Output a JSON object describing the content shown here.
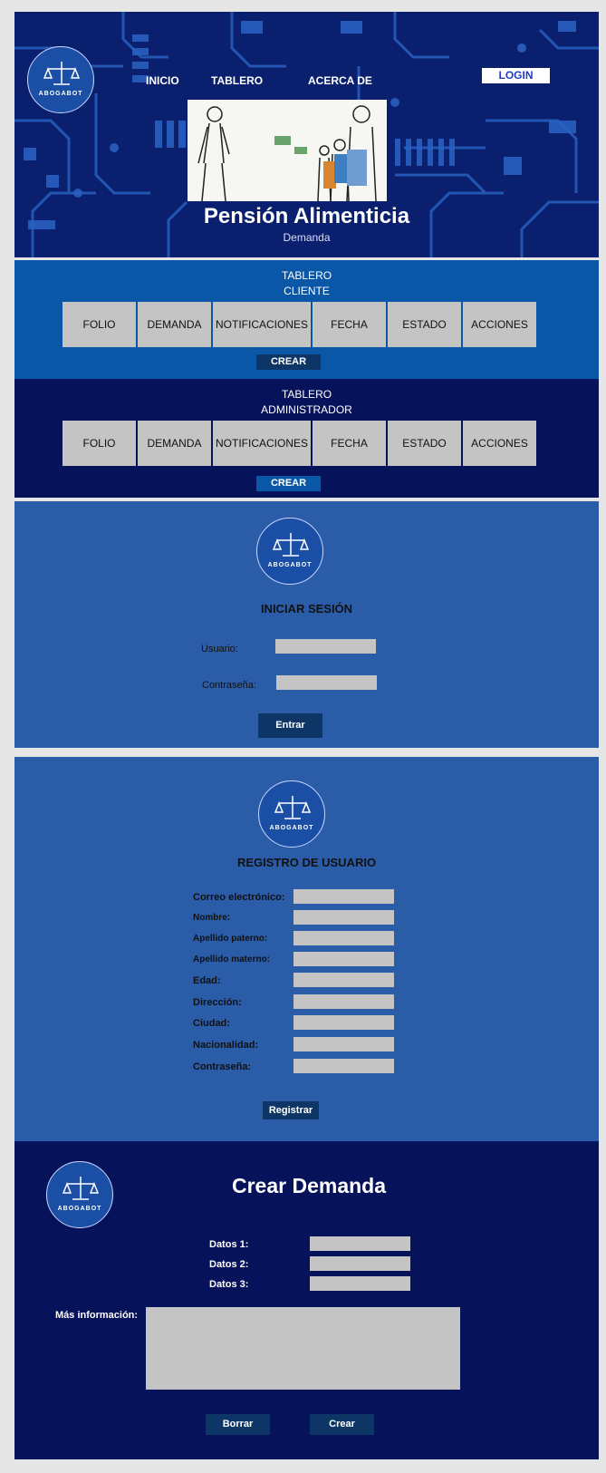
{
  "colors": {
    "hero_bg": "#0a1f6e",
    "client_bg": "#0a57a8",
    "admin_bg": "#06125a",
    "form_bg": "#2b5ca8",
    "field": "#c4c4c4",
    "dark_button": "#0d3566"
  },
  "brand": {
    "logo_text": "ABOGABOT"
  },
  "nav": {
    "inicio": "INICIO",
    "tablero": "TABLERO",
    "acerca": "ACERCA DE",
    "login": "LOGIN"
  },
  "hero": {
    "title": "Pensión Alimenticia",
    "subtitle": "Demanda"
  },
  "client_board": {
    "title_1": "TABLERO",
    "title_2": "CLIENTE",
    "columns": [
      "FOLIO",
      "DEMANDA",
      "NOTIFICACIONES",
      "FECHA",
      "ESTADO",
      "ACCIONES"
    ],
    "button": "CREAR"
  },
  "admin_board": {
    "title_1": "TABLERO",
    "title_2": "ADMINISTRADOR",
    "columns": [
      "FOLIO",
      "DEMANDA",
      "NOTIFICACIONES",
      "FECHA",
      "ESTADO",
      "ACCIONES"
    ],
    "button": "CREAR"
  },
  "login": {
    "title": "INICIAR SESIÓN",
    "user_label": "Usuario:",
    "password_label": "Contraseña:",
    "submit": "Entrar"
  },
  "register": {
    "title": "REGISTRO DE USUARIO",
    "fields": [
      "Correo electrónico:",
      "Nombre:",
      "Apellido paterno:",
      "Apellido materno:",
      "Edad:",
      "Dirección:",
      "Ciudad:",
      "Nacionalidad:",
      "Contraseña:"
    ],
    "submit": "Registrar"
  },
  "demanda": {
    "title": "Crear Demanda",
    "fields": [
      "Datos 1:",
      "Datos 2:",
      "Datos 3:"
    ],
    "more_label": "Más información:",
    "clear": "Borrar",
    "create": "Crear"
  }
}
